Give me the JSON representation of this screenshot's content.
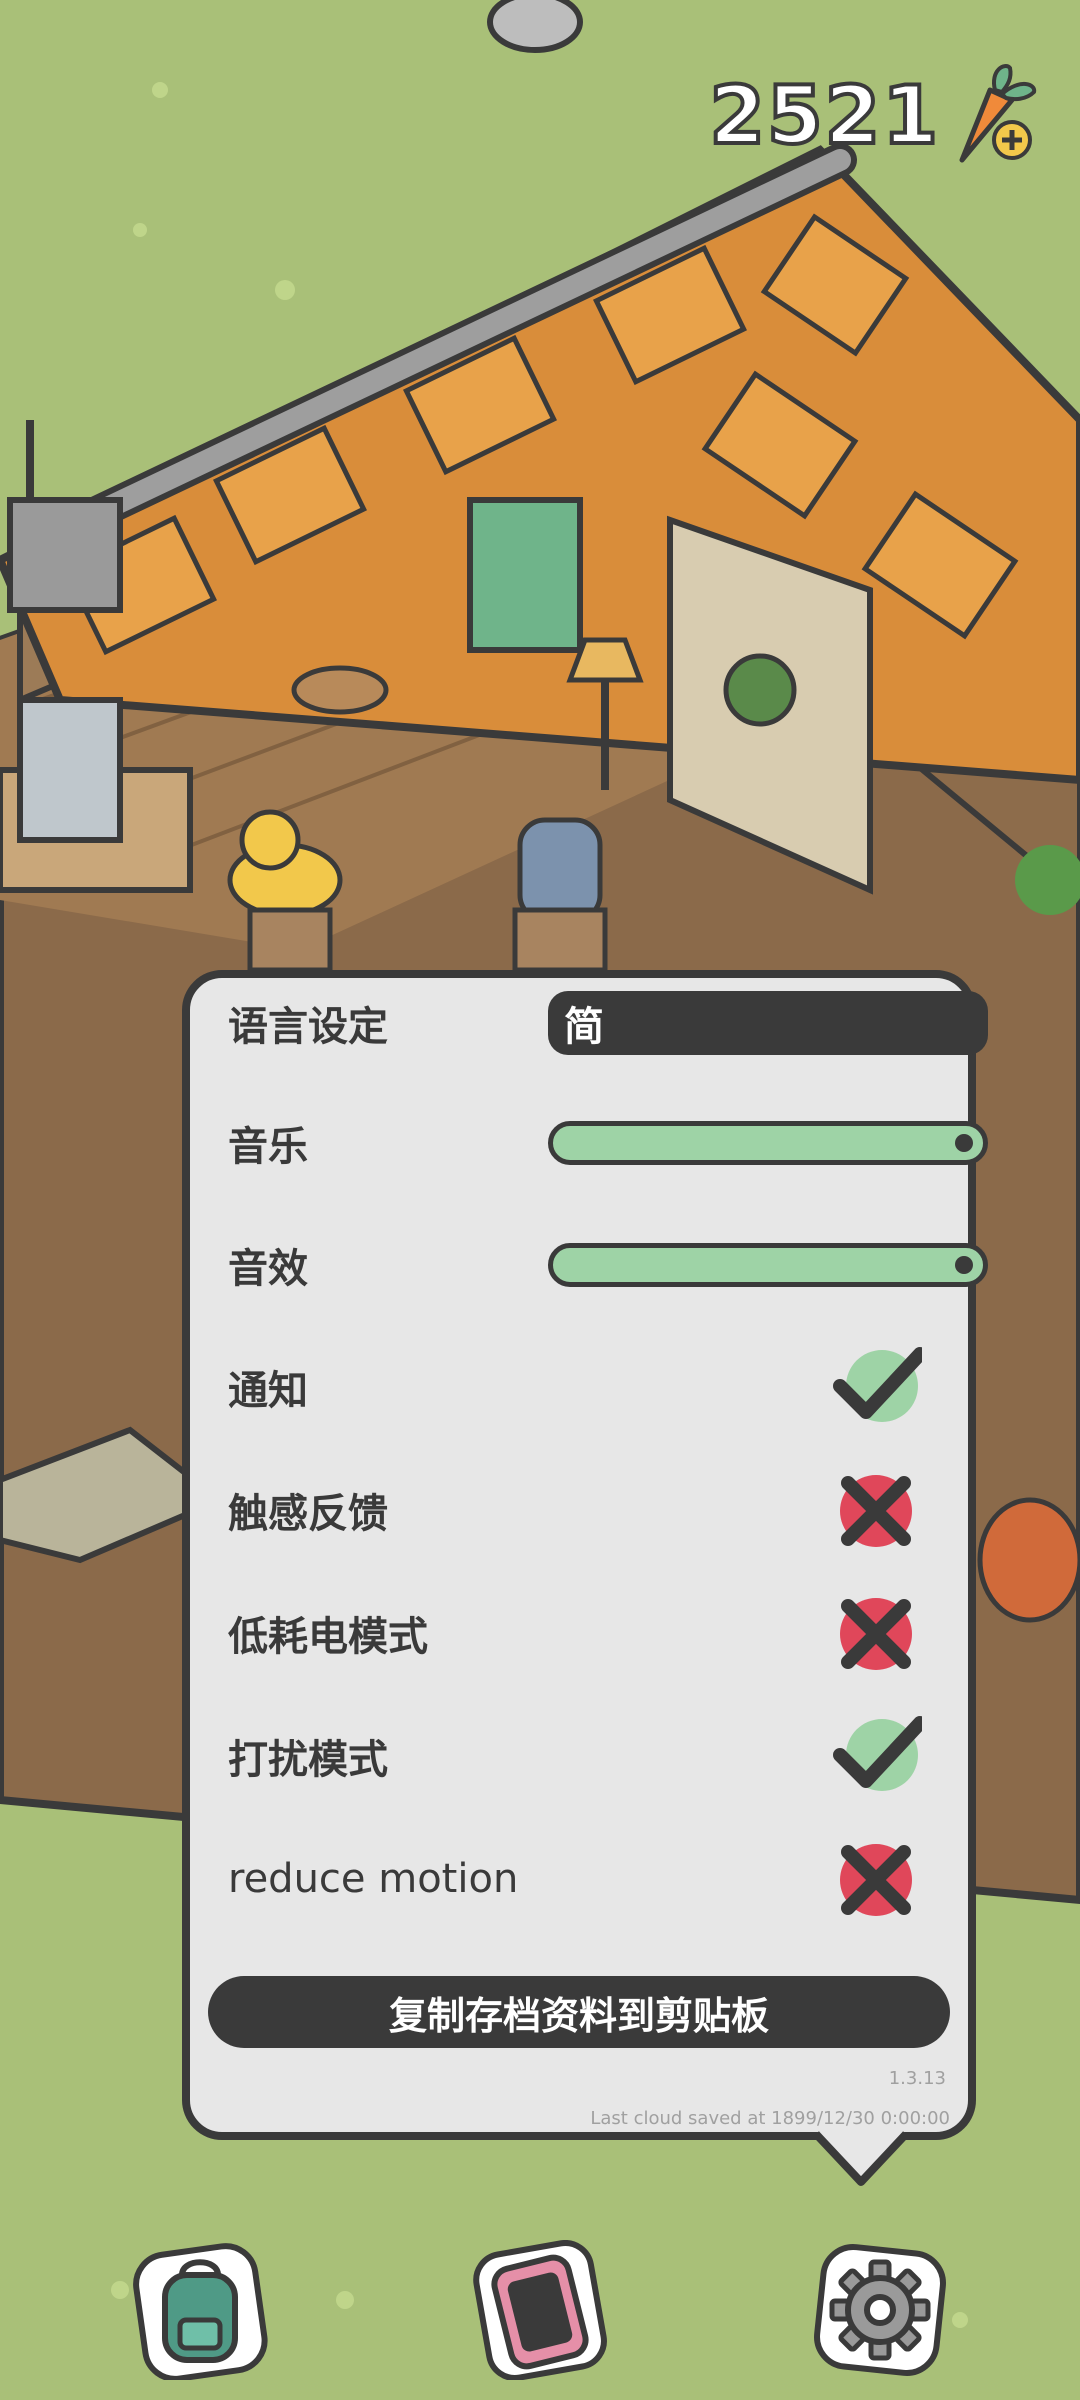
{
  "hud": {
    "currency_value": "2521",
    "currency_icon": "carrot-plus-icon"
  },
  "settings": {
    "language": {
      "label": "语言设定",
      "value": "简"
    },
    "music": {
      "label": "音乐",
      "level": 1.0
    },
    "sound": {
      "label": "音效",
      "level": 1.0
    },
    "toggles": [
      {
        "label": "通知",
        "state": "on"
      },
      {
        "label": "触感反馈",
        "state": "off"
      },
      {
        "label": "低耗电模式",
        "state": "off"
      },
      {
        "label": "打扰模式",
        "state": "on"
      },
      {
        "label": "reduce motion",
        "state": "off"
      }
    ],
    "copy_button": "复制存档资料到剪贴板",
    "version": "1.3.13",
    "cloud_saved": "Last cloud saved at 1899/12/30 0:00:00"
  },
  "nav": [
    {
      "icon": "backpack-icon"
    },
    {
      "icon": "phone-icon"
    },
    {
      "icon": "gear-icon"
    }
  ],
  "colors": {
    "grass": "#a9c078",
    "panel_bg": "#e7e7e7",
    "dark": "#3a3a3a",
    "slider_fill": "#9ed3a6",
    "on_green": "#9ed3a6",
    "off_red": "#e0475a"
  }
}
